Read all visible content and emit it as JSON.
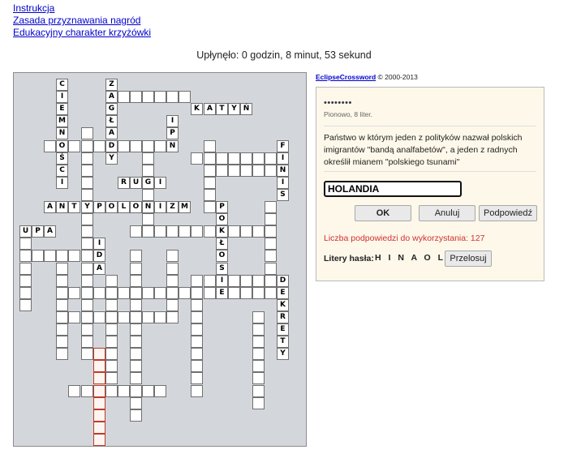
{
  "links": [
    "Instrukcja",
    "Zasada przyznawania nagród",
    "Edukacyjny charakter krzyżówki"
  ],
  "timer": "Upłynęło: 0 godzin, 8 minut, 53 sekund",
  "credit": {
    "link": "EclipseCrossword",
    "text": "© 2000-2013"
  },
  "clue_panel": {
    "dots": "••••••••",
    "direction": "Pionowo, 8 liter.",
    "clue": "Państwo w którym jeden z polityków nazwał polskich imigrantów \"bandą analfabetów\", a jeden z radnych określił mianem \"polskiego tsunami\"",
    "answer_value": "HOLANDIA",
    "buttons": {
      "ok": "OK",
      "cancel": "Anuluj",
      "hint": "Podpowiedź",
      "shuffle": "Przelosuj"
    },
    "hints_left": "Liczba podpowiedzi do wykorzystania: 127",
    "letters_label": "Litery hasła:",
    "letters": "H I N A O L A D"
  },
  "colors": {
    "board": "#d3d7dc",
    "active_border": "#c0392b",
    "hint_red": "#d32f2f",
    "panel": "#fdf8ea"
  },
  "crossword": {
    "cols": 24,
    "rows": 30,
    "words": [
      {
        "answer": "CIEMNOŚCI",
        "dir": "down",
        "row": 0,
        "col": 3,
        "filled": true
      },
      {
        "answer": "ZAGŁADY",
        "dir": "down",
        "row": 0,
        "col": 7,
        "filled": true
      },
      {
        "answer": "KATYŃ",
        "dir": "across",
        "row": 2,
        "col": 14,
        "filled": true
      },
      {
        "answer": "IPN",
        "dir": "down",
        "row": 3,
        "col": 12,
        "filled": true
      },
      {
        "answer": "FINIS",
        "dir": "down",
        "row": 5,
        "col": 21,
        "filled": true
      },
      {
        "answer": "RUGI",
        "dir": "across",
        "row": 8,
        "col": 8,
        "filled": true
      },
      {
        "answer": "ANTYPOLONIZM",
        "dir": "across",
        "row": 10,
        "col": 2,
        "filled": true
      },
      {
        "answer": "POKŁOSIE",
        "dir": "down",
        "row": 10,
        "col": 16,
        "filled": true
      },
      {
        "answer": "UPA",
        "dir": "across",
        "row": 12,
        "col": 0,
        "filled": true
      },
      {
        "answer": "IDA",
        "dir": "down",
        "row": 13,
        "col": 6,
        "filled": true
      },
      {
        "answer": "DEKRETY",
        "dir": "down",
        "row": 16,
        "col": 21,
        "filled": true
      },
      {
        "answer": "????????",
        "dir": "down",
        "row": 22,
        "col": 6,
        "filled": false,
        "active": true
      },
      {
        "answer": "???????",
        "dir": "across",
        "row": 1,
        "col": 7,
        "filled": false
      },
      {
        "answer": "??????????",
        "dir": "across",
        "row": 5,
        "col": 2,
        "filled": false
      },
      {
        "answer": "??????",
        "dir": "across",
        "row": 7,
        "col": 15,
        "filled": false
      },
      {
        "answer": "???????????",
        "dir": "across",
        "row": 12,
        "col": 9,
        "filled": false
      },
      {
        "answer": "???????",
        "dir": "down",
        "row": 12,
        "col": 0,
        "filled": false
      },
      {
        "answer": "??????",
        "dir": "across",
        "row": 14,
        "col": 0,
        "filled": false
      },
      {
        "answer": "??????????????",
        "dir": "across",
        "row": 17,
        "col": 3,
        "filled": false
      },
      {
        "answer": "?????????",
        "dir": "across",
        "row": 17,
        "col": 13,
        "filled": false
      },
      {
        "answer": "????????",
        "dir": "down",
        "row": 15,
        "col": 3,
        "filled": false
      },
      {
        "answer": "??????????",
        "dir": "down",
        "row": 16,
        "col": 7,
        "filled": false
      },
      {
        "answer": "??????????????",
        "dir": "down",
        "row": 14,
        "col": 9,
        "filled": false
      },
      {
        "answer": "??????",
        "dir": "down",
        "row": 14,
        "col": 12,
        "filled": false
      },
      {
        "answer": "??????????",
        "dir": "across",
        "row": 19,
        "col": 3,
        "filled": false
      },
      {
        "answer": "?????????",
        "dir": "down",
        "row": 17,
        "col": 14,
        "filled": false
      },
      {
        "answer": "????????",
        "dir": "down",
        "row": 19,
        "col": 19,
        "filled": false
      },
      {
        "answer": "????????",
        "dir": "across",
        "row": 25,
        "col": 4,
        "filled": false
      },
      {
        "answer": "?????????????",
        "dir": "down",
        "row": 10,
        "col": 5,
        "filled": false
      },
      {
        "answer": "??????",
        "dir": "down",
        "row": 10,
        "col": 20,
        "filled": false
      },
      {
        "answer": "????????",
        "dir": "across",
        "row": 16,
        "col": 14,
        "filled": false
      },
      {
        "answer": "??????",
        "dir": "down",
        "row": 4,
        "col": 5,
        "filled": false
      },
      {
        "answer": "???????",
        "dir": "down",
        "row": 5,
        "col": 10,
        "filled": false
      },
      {
        "answer": "??????",
        "dir": "down",
        "row": 5,
        "col": 15,
        "filled": false
      },
      {
        "answer": "????????",
        "dir": "across",
        "row": 6,
        "col": 14,
        "filled": false
      }
    ]
  }
}
